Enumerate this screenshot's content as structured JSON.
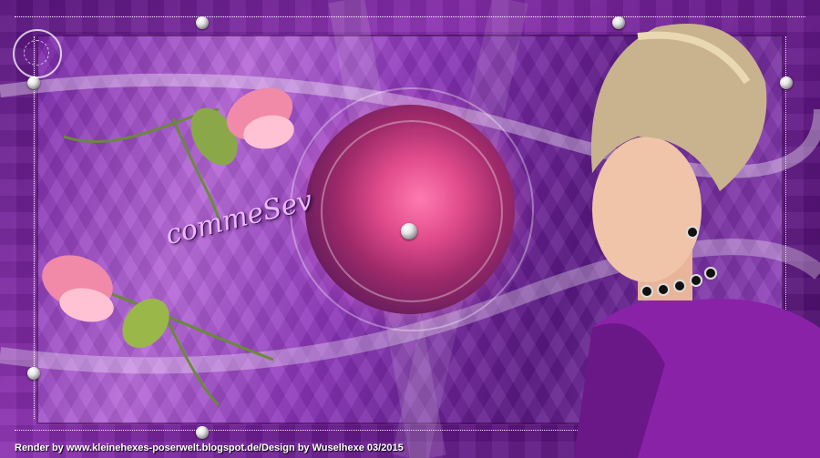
{
  "artwork": {
    "signature_text": "commeSev",
    "credit_text": "Render by www.kleinehexes-poserwelt.blogspot.de/Design by Wuselhexe 03/2015",
    "colors": {
      "background": "#6a1a90",
      "accent_pink": "#e24c8c",
      "lace": "#ffffff",
      "dress": "#8a22a8"
    }
  }
}
